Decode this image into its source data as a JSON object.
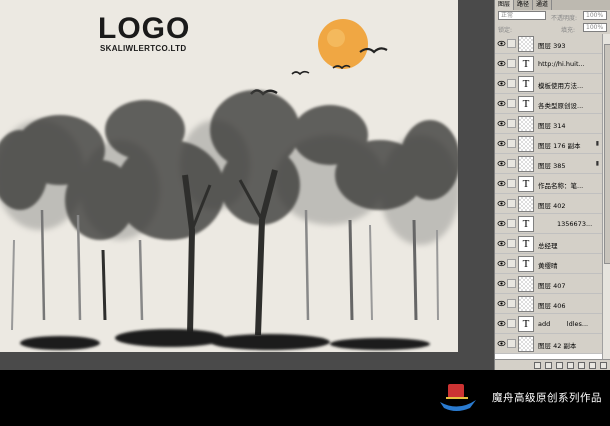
{
  "artwork": {
    "logo_title": "LOGO",
    "logo_subtitle": "SKALIWLERTCO.LTD",
    "sun_color": "#f0a040"
  },
  "layers_panel": {
    "tabs": [
      "图层",
      "路径",
      "通道"
    ],
    "blend_mode": "正常",
    "opacity_label": "不透明度:",
    "opacity_value": "100%",
    "lock_label": "锁定:",
    "fill_label": "填充:",
    "fill_value": "100%",
    "layers": [
      {
        "name": "图层 393",
        "kind": "pixel",
        "locked": false
      },
      {
        "name": "http://hi.huit...",
        "kind": "text",
        "locked": false
      },
      {
        "name": "模板使用方法...",
        "kind": "text",
        "locked": false
      },
      {
        "name": "各类型原创设...",
        "kind": "text",
        "locked": false
      },
      {
        "name": "图层 314",
        "kind": "pixel",
        "locked": false
      },
      {
        "name": "图层 176 副本",
        "kind": "pixel",
        "locked": true
      },
      {
        "name": "图层 385",
        "kind": "pixel",
        "locked": true
      },
      {
        "name": "作品名称：笔...",
        "kind": "text",
        "locked": false
      },
      {
        "name": "图层 402",
        "kind": "pixel",
        "locked": false
      },
      {
        "name": "1356673...",
        "kind": "text",
        "locked": false
      },
      {
        "name": "总经理",
        "kind": "text",
        "locked": false
      },
      {
        "name": "黄缨晴",
        "kind": "text",
        "locked": false
      },
      {
        "name": "图层 407",
        "kind": "pixel",
        "locked": false
      },
      {
        "name": "图层 406",
        "kind": "pixel",
        "locked": false
      },
      {
        "name": "add        ldles...",
        "kind": "text",
        "locked": false
      },
      {
        "name": "图层 42 副本",
        "kind": "pixel",
        "locked": false
      }
    ]
  },
  "caption": {
    "text": "魔舟高级原创系列作品",
    "logo_icon": "boat-logo-icon"
  }
}
